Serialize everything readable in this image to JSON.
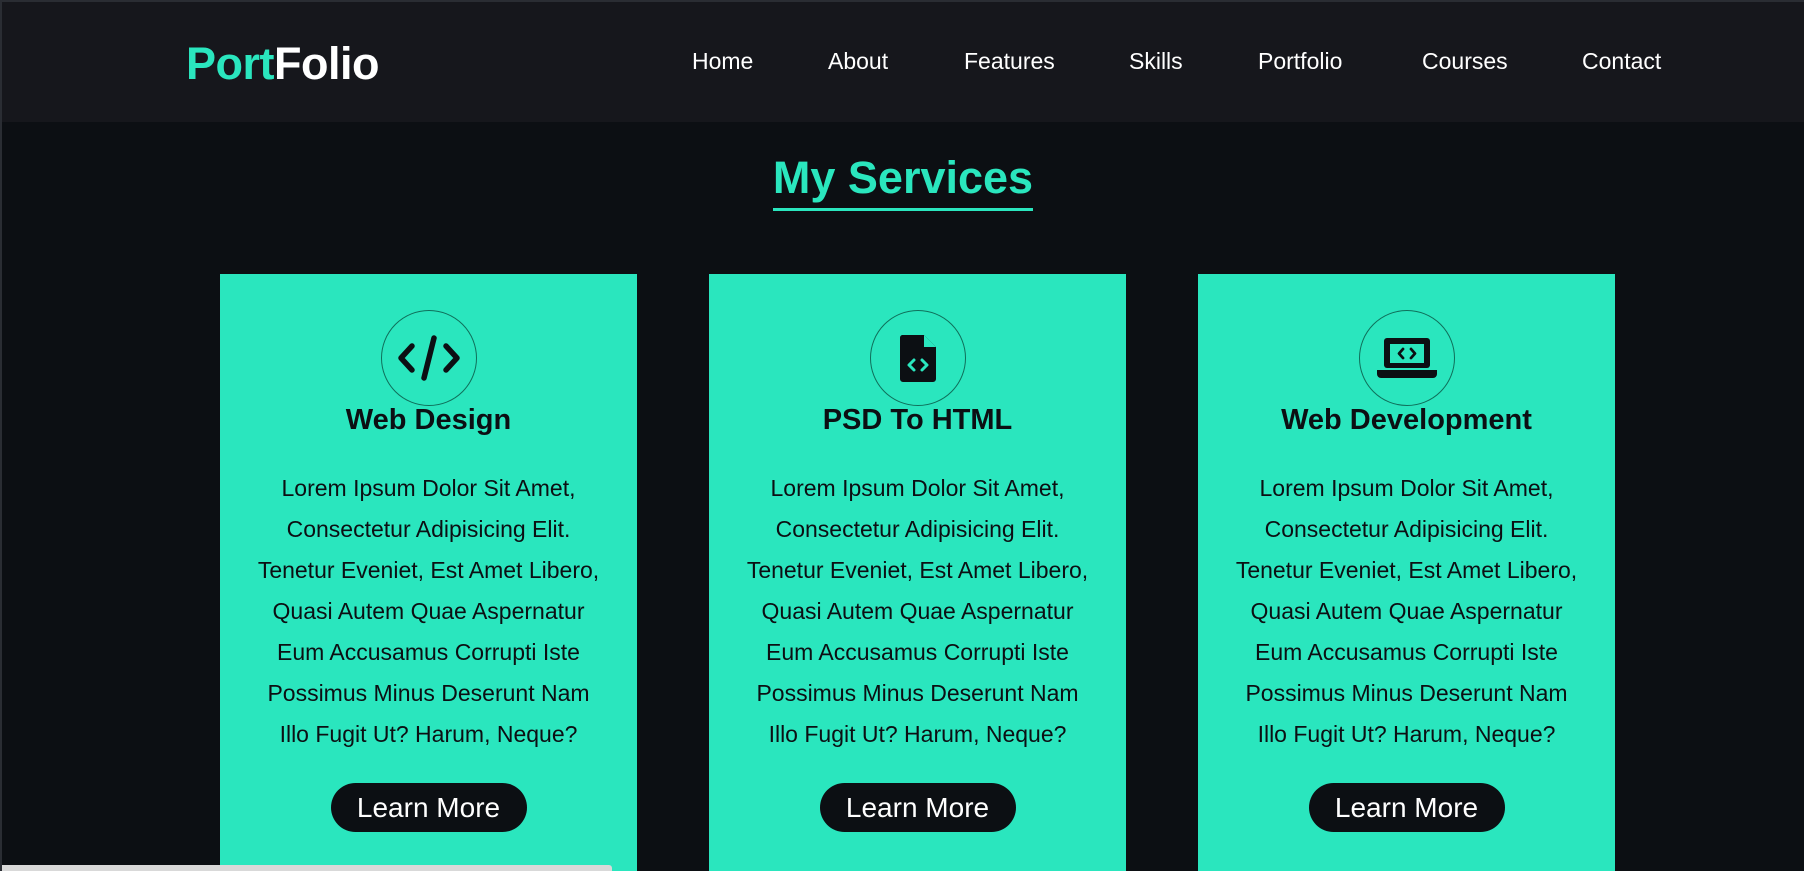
{
  "header": {
    "logo_accent": "Port",
    "logo_rest": "Folio",
    "nav": [
      "Home",
      "About",
      "Features",
      "Skills",
      "Portfolio",
      "Courses",
      "Contact"
    ]
  },
  "section": {
    "title": "My Services"
  },
  "cards": [
    {
      "icon": "code-icon",
      "title": "Web Design",
      "text": "Lorem Ipsum Dolor Sit Amet, Consectetur Adipisicing Elit. Tenetur Eveniet, Est Amet Libero, Quasi Autem Quae Aspernatur Eum Accusamus Corrupti Iste Possimus Minus Deserunt Nam Illo Fugit Ut? Harum, Neque?",
      "button": "Learn More"
    },
    {
      "icon": "file-code-icon",
      "title": "PSD To HTML",
      "text": "Lorem Ipsum Dolor Sit Amet, Consectetur Adipisicing Elit. Tenetur Eveniet, Est Amet Libero, Quasi Autem Quae Aspernatur Eum Accusamus Corrupti Iste Possimus Minus Deserunt Nam Illo Fugit Ut? Harum, Neque?",
      "button": "Learn More"
    },
    {
      "icon": "laptop-code-icon",
      "title": "Web Development",
      "text": "Lorem Ipsum Dolor Sit Amet, Consectetur Adipisicing Elit. Tenetur Eveniet, Est Amet Libero, Quasi Autem Quae Aspernatur Eum Accusamus Corrupti Iste Possimus Minus Deserunt Nam Illo Fugit Ut? Harum, Neque?",
      "button": "Learn More"
    }
  ],
  "colors": {
    "accent": "#2ae6be",
    "background": "#0c0f13",
    "header": "#16171c",
    "text_dark": "#0c0f13",
    "text_light": "#ffffff"
  }
}
